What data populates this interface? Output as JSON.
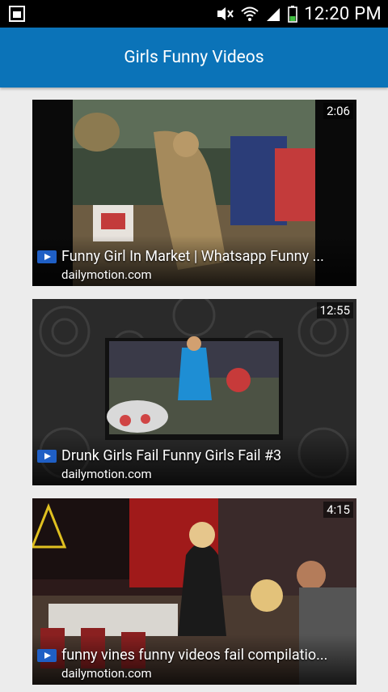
{
  "status_bar": {
    "time": "12:20 PM",
    "icons": [
      "sim-card-icon",
      "mute-icon",
      "wifi-icon",
      "signal-icon",
      "battery-icon"
    ]
  },
  "header": {
    "title": "Girls Funny Videos"
  },
  "videos": [
    {
      "duration": "2:06",
      "title": "Funny Girl In Market | Whatsapp Funny ...",
      "source": "dailymotion.com"
    },
    {
      "duration": "12:55",
      "title": "Drunk Girls Fail Funny Girls Fail #3",
      "source": "dailymotion.com"
    },
    {
      "duration": "4:15",
      "title": "funny vines funny videos fail compilatio...",
      "source": "dailymotion.com"
    }
  ],
  "colors": {
    "appbar": "#0b73b8",
    "play_icon": "#1f5fc5"
  }
}
